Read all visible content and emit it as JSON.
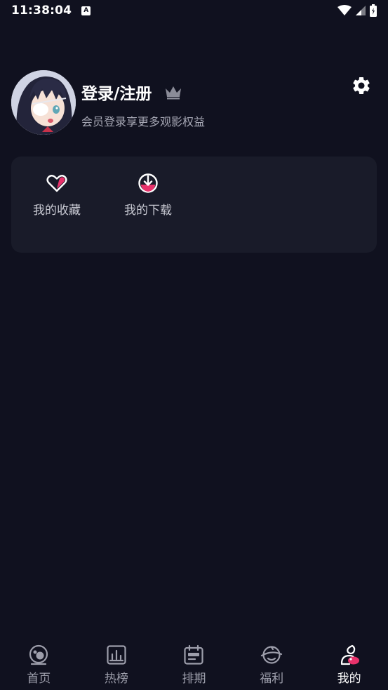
{
  "status_bar": {
    "time": "11:38:04",
    "notification_icon": "A"
  },
  "profile": {
    "title": "登录/注册",
    "subtitle": "会员登录享更多观影权益",
    "avatar_icon": "anime-avatar",
    "vip_icon": "crown-icon",
    "settings_icon": "gear-icon"
  },
  "quick_actions": [
    {
      "label": "我的收藏",
      "icon": "heart-icon"
    },
    {
      "label": "我的下载",
      "icon": "download-icon"
    }
  ],
  "bottom_nav": [
    {
      "label": "首页",
      "icon": "home-icon",
      "active": false
    },
    {
      "label": "热榜",
      "icon": "chart-icon",
      "active": false
    },
    {
      "label": "排期",
      "icon": "calendar-icon",
      "active": false
    },
    {
      "label": "福利",
      "icon": "gift-icon",
      "active": false
    },
    {
      "label": "我的",
      "icon": "profile-icon",
      "active": true
    }
  ],
  "colors": {
    "background": "#10111f",
    "card": "#191b29",
    "accent": "#e8326b",
    "muted_text": "#a7a8b5"
  }
}
